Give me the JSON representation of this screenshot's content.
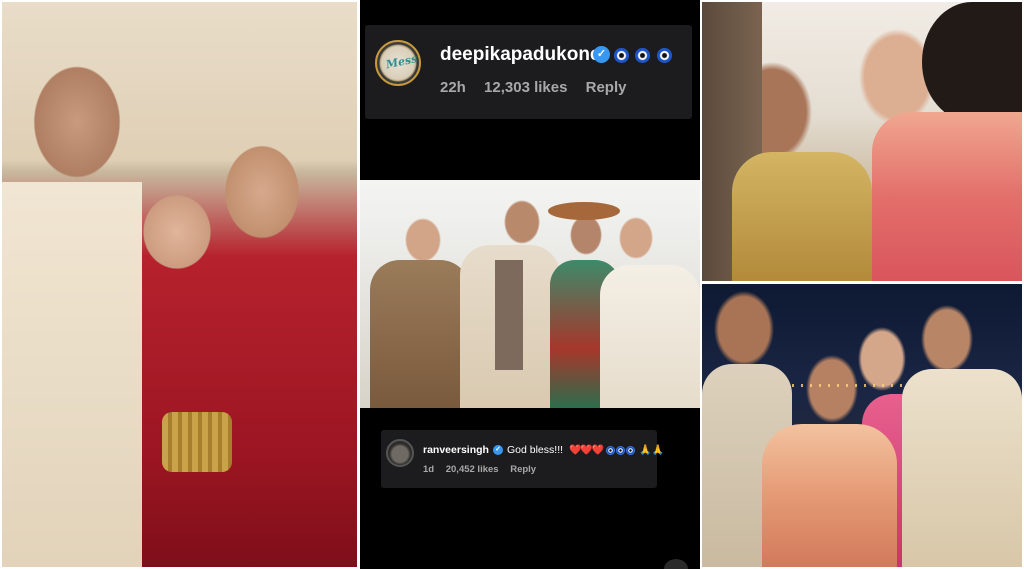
{
  "comment_top": {
    "username": "deepikapadukone",
    "verified_mark": "✓",
    "emojis": [
      "nazar-amulet",
      "nazar-amulet",
      "nazar-amulet"
    ],
    "time": "22h",
    "likes": "12,303 likes",
    "reply": "Reply",
    "avatar_text": "Mess"
  },
  "comment_bottom": {
    "username": "ranveersingh",
    "verified_mark": "✓",
    "text": "God bless!!!",
    "hearts": "❤️❤️❤️",
    "pray": "🙏🙏",
    "time": "1d",
    "likes": "20,452 likes",
    "reply": "Reply"
  },
  "colors": {
    "comment_bg": "#1c1c1e",
    "verified_blue": "#3897f0",
    "meta_grey": "#a8a8a8",
    "heart_red": "#e0243a"
  }
}
